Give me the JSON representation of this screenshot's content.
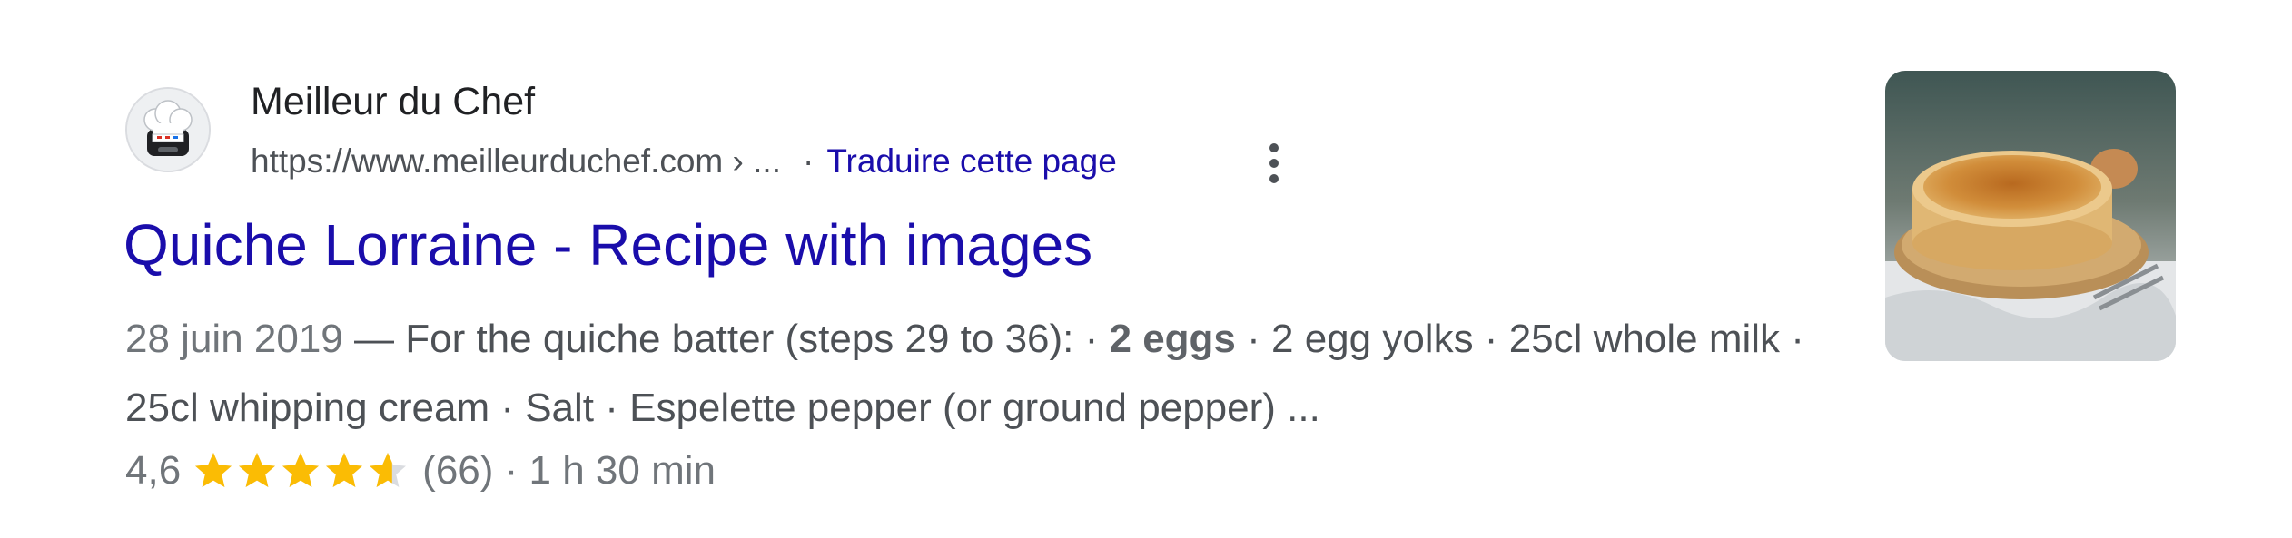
{
  "result": {
    "site_name": "Meilleur du Chef",
    "url": "https://www.meilleurduchef.com › ...",
    "separator": "·",
    "translate_link": "Traduire cette page",
    "title": "Quiche Lorraine - Recipe with images",
    "snippet": {
      "date": "28 juin 2019",
      "dash": " — ",
      "text_before_bold": "For the quiche batter (steps 29 to 36): · ",
      "bold": "2 eggs",
      "text_after_bold": " · 2 egg yolks · 25cl whole milk · 25cl whipping cream · Salt · Espelette pepper (or ground pepper) ..."
    },
    "rating": {
      "value": "4,6",
      "stars_value": 4.6,
      "stars_max": 5,
      "count": "(66)",
      "separator": " · ",
      "duration": "1 h 30 min"
    },
    "icons": {
      "favicon": "chef-hat-logo-icon",
      "menu": "more-vert-icon",
      "star": "star-icon",
      "thumbnail": "quiche-photo"
    },
    "colors": {
      "link": "#1a0dab",
      "text": "#4d5156",
      "star": "#fbbc04"
    }
  }
}
